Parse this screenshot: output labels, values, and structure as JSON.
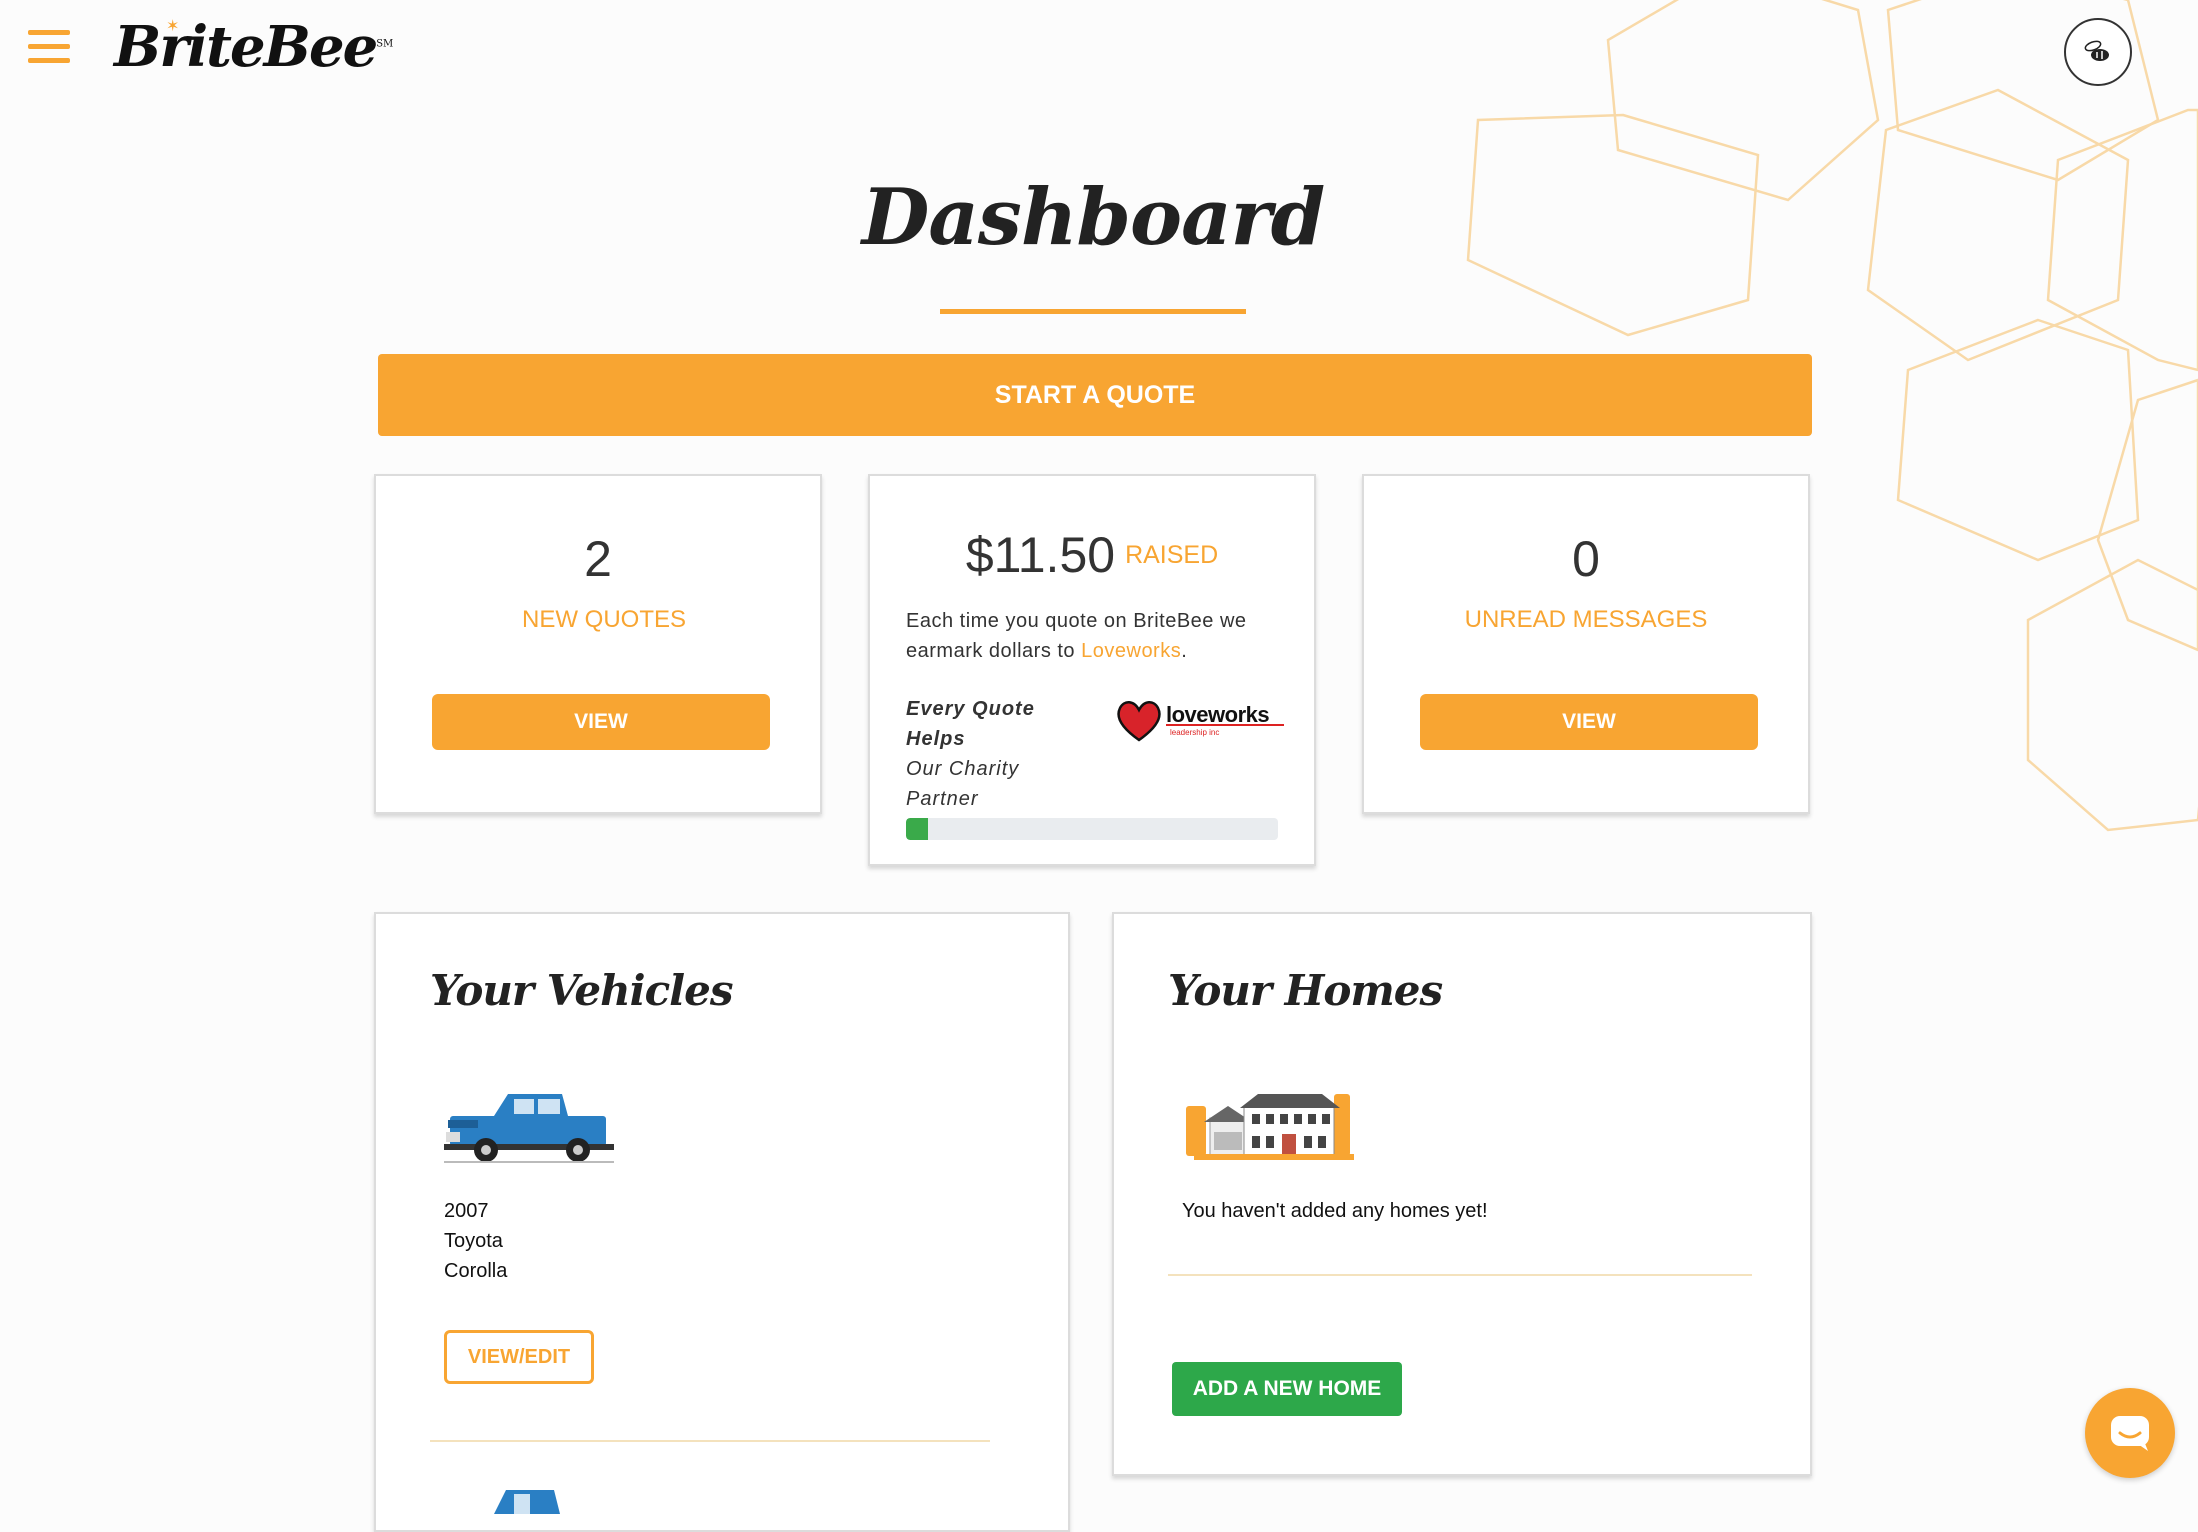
{
  "header": {
    "logo_text": "BriteBee",
    "logo_mark": "SM",
    "menu_icon": "hamburger-menu-icon",
    "avatar_icon": "bee-avatar-icon"
  },
  "page": {
    "title": "Dashboard"
  },
  "actions": {
    "start_quote": "START A QUOTE"
  },
  "stats": {
    "quotes": {
      "count": "2",
      "label": "NEW QUOTES",
      "button": "VIEW"
    },
    "charity": {
      "amount": "$11.50",
      "raised_label": "RAISED",
      "desc_prefix": "Each time you quote on BriteBee we earmark dollars to ",
      "charity_name": "Loveworks",
      "desc_suffix": ".",
      "tagline_bold": "Every Quote Helps",
      "tagline": "Our Charity Partner",
      "logo_text": "loveworks",
      "logo_sub": "leadership inc",
      "progress": 0.06
    },
    "messages": {
      "count": "0",
      "label": "UNREAD MESSAGES",
      "button": "VIEW"
    }
  },
  "vehicles": {
    "title": "Your Vehicles",
    "items": [
      {
        "year": "2007",
        "make": "Toyota",
        "model": "Corolla",
        "button": "VIEW/EDIT",
        "icon": "blue-pickup-truck-icon"
      }
    ]
  },
  "homes": {
    "title": "Your Homes",
    "empty_text": "You haven't added any homes yet!",
    "add_button": "ADD A NEW HOME",
    "icon": "house-illustration-icon"
  },
  "chat": {
    "icon": "chat-bubble-icon"
  },
  "colors": {
    "accent": "#f8a532",
    "success": "#2da84a",
    "text": "#333333"
  }
}
